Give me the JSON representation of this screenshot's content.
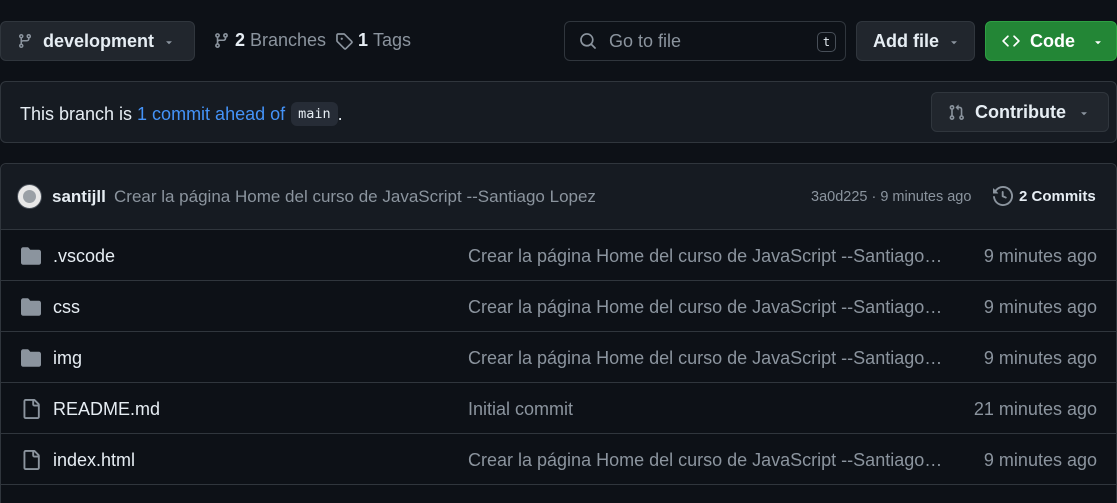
{
  "toolbar": {
    "branch": "development",
    "branches_count": "2",
    "branches_label": "Branches",
    "tags_count": "1",
    "tags_label": "Tags",
    "search_placeholder": "Go to file",
    "search_shortcut": "t",
    "add_file_label": "Add file",
    "code_label": "Code"
  },
  "ahead": {
    "prefix": "This branch is",
    "link": "1 commit ahead of",
    "base_branch": "main",
    "suffix": ".",
    "contribute_label": "Contribute"
  },
  "latest_commit": {
    "author": "santijll",
    "message": "Crear la página Home del curso de JavaScript --Santiago Lopez",
    "sha_time": "3a0d225 · 9 minutes ago",
    "commits_label": "2 Commits"
  },
  "files": [
    {
      "type": "folder",
      "name": ".vscode",
      "message": "Crear la página Home del curso de JavaScript --Santiago Lopez",
      "time": "9 minutes ago"
    },
    {
      "type": "folder",
      "name": "css",
      "message": "Crear la página Home del curso de JavaScript --Santiago Lopez",
      "time": "9 minutes ago"
    },
    {
      "type": "folder",
      "name": "img",
      "message": "Crear la página Home del curso de JavaScript --Santiago Lopez",
      "time": "9 minutes ago"
    },
    {
      "type": "file",
      "name": "README.md",
      "message": "Initial commit",
      "time": "21 minutes ago"
    },
    {
      "type": "file",
      "name": "index.html",
      "message": "Crear la página Home del curso de JavaScript --Santiago Lopez",
      "time": "9 minutes ago"
    }
  ],
  "colors": {
    "background": "#0d1117",
    "accent_link": "#4493f8",
    "primary_button": "#238636",
    "folder_icon": "#8b949e"
  },
  "icons": {
    "branch": "git-branch-icon",
    "tag": "tag-icon",
    "search": "search-icon",
    "code": "code-icon",
    "contribute": "git-pull-request-icon",
    "history": "history-icon",
    "folder": "folder-icon",
    "file": "file-icon"
  }
}
